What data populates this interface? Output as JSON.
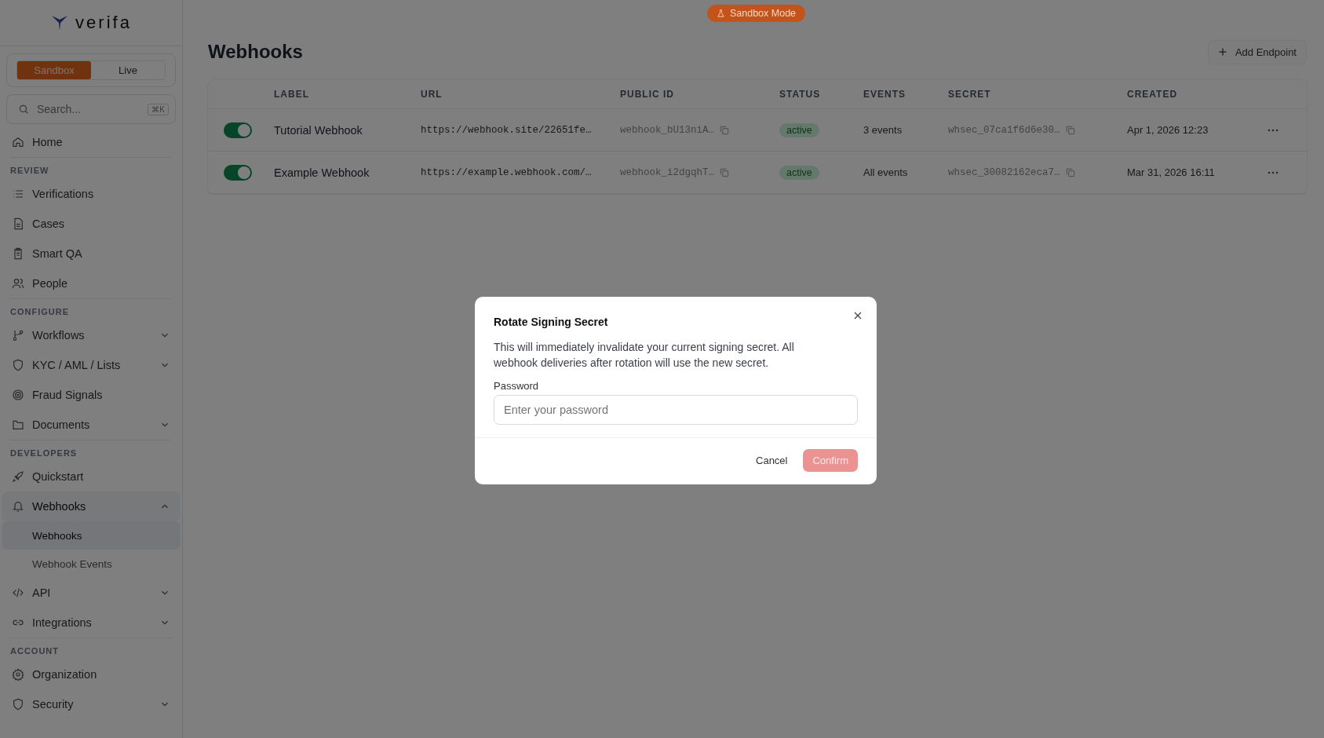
{
  "sidebar": {
    "logo": "verifa",
    "mode_switch": [
      {
        "label": "Sandbox",
        "selected": true
      },
      {
        "label": "Live",
        "selected": false
      }
    ],
    "search": {
      "placeholder": "Search...",
      "shortcut": "⌘K"
    },
    "sections": [
      {
        "items": [
          {
            "label": "Home"
          }
        ]
      },
      {
        "title": "REVIEW",
        "items": [
          {
            "label": "Verifications"
          },
          {
            "label": "Cases"
          },
          {
            "label": "Smart QA"
          },
          {
            "label": "People"
          }
        ]
      },
      {
        "title": "CONFIGURE",
        "items": [
          {
            "label": "Workflows",
            "expanded": false
          },
          {
            "label": "KYC / AML / Lists",
            "expanded": false
          },
          {
            "label": "Fraud Signals"
          },
          {
            "label": "Documents",
            "expanded": false
          }
        ]
      },
      {
        "title": "DEVELOPERS",
        "items": [
          {
            "label": "Quickstart"
          },
          {
            "label": "Webhooks",
            "expanded": true,
            "children": [
              {
                "label": "Webhooks",
                "selected": true
              },
              {
                "label": "Webhook Events",
                "selected": false
              }
            ]
          },
          {
            "label": "API",
            "expanded": false
          },
          {
            "label": "Integrations",
            "expanded": false
          }
        ]
      },
      {
        "title": "ACCOUNT",
        "items": [
          {
            "label": "Organization"
          },
          {
            "label": "Security",
            "expanded": false
          }
        ]
      }
    ]
  },
  "mode_badge": "Sandbox Mode",
  "page": {
    "title": "Webhooks",
    "add_button": "Add Endpoint"
  },
  "table": {
    "columns": [
      "LABEL",
      "URL",
      "PUBLIC ID",
      "STATUS",
      "EVENTS",
      "SECRET",
      "CREATED"
    ],
    "rows": [
      {
        "on": true,
        "label": "Tutorial Webhook",
        "url": "https://webhook.site/22651fe…",
        "public_id": "webhook_bU13niA…",
        "status": "active",
        "events": "3 events",
        "secret": "whsec_07ca1f6d6e30…",
        "created": "Apr 1, 2026 12:23"
      },
      {
        "on": true,
        "label": "Example Webhook",
        "url": "https://example.webhook.com/…",
        "public_id": "webhook_i2dgqhT…",
        "status": "active",
        "events": "All events",
        "secret": "whsec_30082162eca7…",
        "created": "Mar 31, 2026 16:11"
      }
    ]
  },
  "dialog": {
    "title": "Rotate Signing Secret",
    "message": "This will immediately invalidate your current signing secret. All webhook deliveries after rotation will use the new secret.",
    "field_label": "Password",
    "placeholder": "Enter your password",
    "cancel": "Cancel",
    "confirm": {
      "label": "Confirm",
      "disabled": true
    }
  }
}
